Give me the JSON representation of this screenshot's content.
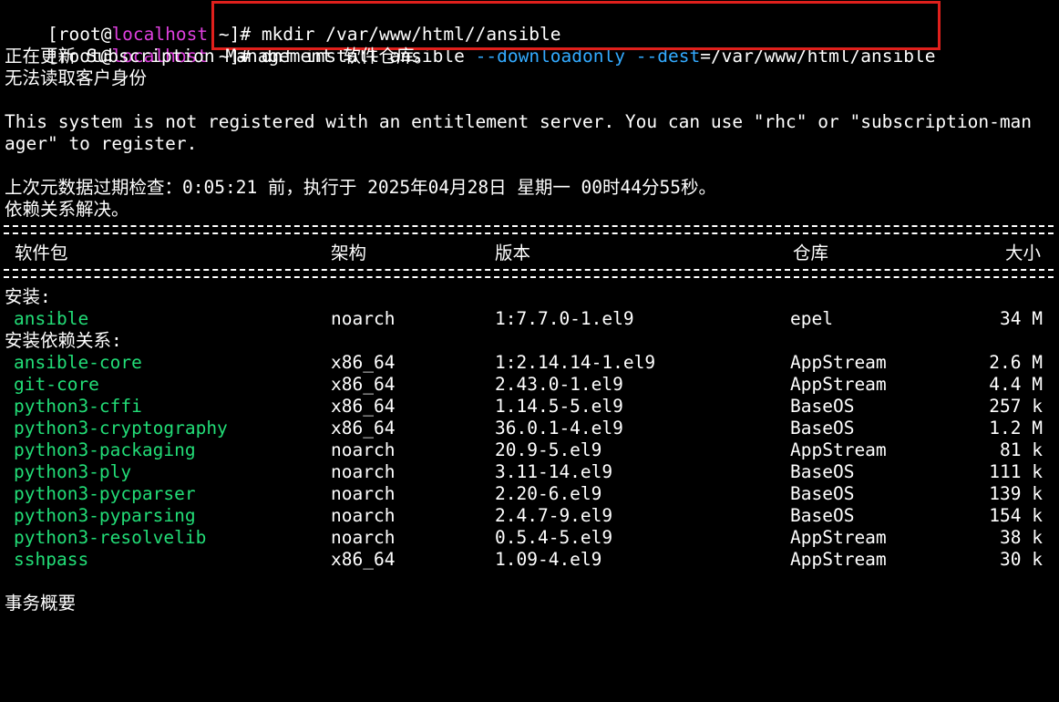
{
  "prompt": {
    "bracket_open": "[",
    "user": "root",
    "at": "@",
    "host": "localhost",
    "dir_and_sign": " ~]# "
  },
  "commands": [
    {
      "text": "mkdir /var/www/html//ansible"
    },
    {
      "pre": "dnf install ansible ",
      "opt1": "--downloadonly",
      "mid": " ",
      "opt2": "--dest",
      "post": "=/var/www/html/ansible"
    }
  ],
  "output": {
    "line1": "正在更新 Subscription Management 软件仓库。",
    "line2": "无法读取客户身份",
    "line3": "This system is not registered with an entitlement server. You can use \"rhc\" or \"subscription-man",
    "line4": "ager\" to register.",
    "line5": "上次元数据过期检查：0:05:21 前，执行于 2025年04月28日 星期一 00时44分55秒。",
    "line6": "依赖关系解决。"
  },
  "table": {
    "headers": {
      "name": "软件包",
      "arch": "架构",
      "version": "版本",
      "repo": "仓库",
      "size": "大小"
    },
    "install_label": "安装:",
    "install": [
      {
        "name": "ansible",
        "arch": "noarch",
        "version": "1:7.7.0-1.el9",
        "repo": "epel",
        "size": "34 M"
      }
    ],
    "deps_label": "安装依赖关系:",
    "deps": [
      {
        "name": "ansible-core",
        "arch": "x86_64",
        "version": "1:2.14.14-1.el9",
        "repo": "AppStream",
        "size": "2.6 M"
      },
      {
        "name": "git-core",
        "arch": "x86_64",
        "version": "2.43.0-1.el9",
        "repo": "AppStream",
        "size": "4.4 M"
      },
      {
        "name": "python3-cffi",
        "arch": "x86_64",
        "version": "1.14.5-5.el9",
        "repo": "BaseOS",
        "size": "257 k"
      },
      {
        "name": "python3-cryptography",
        "arch": "x86_64",
        "version": "36.0.1-4.el9",
        "repo": "BaseOS",
        "size": "1.2 M"
      },
      {
        "name": "python3-packaging",
        "arch": "noarch",
        "version": "20.9-5.el9",
        "repo": "AppStream",
        "size": "81 k"
      },
      {
        "name": "python3-ply",
        "arch": "noarch",
        "version": "3.11-14.el9",
        "repo": "BaseOS",
        "size": "111 k"
      },
      {
        "name": "python3-pycparser",
        "arch": "noarch",
        "version": "2.20-6.el9",
        "repo": "BaseOS",
        "size": "139 k"
      },
      {
        "name": "python3-pyparsing",
        "arch": "noarch",
        "version": "2.4.7-9.el9",
        "repo": "BaseOS",
        "size": "154 k"
      },
      {
        "name": "python3-resolvelib",
        "arch": "noarch",
        "version": "0.5.4-5.el9",
        "repo": "AppStream",
        "size": "38 k"
      },
      {
        "name": "sshpass",
        "arch": "x86_64",
        "version": "1.09-4.el9",
        "repo": "AppStream",
        "size": "30 k"
      }
    ]
  },
  "summary_label": "事务概要",
  "colors": {
    "background": "#000000",
    "text": "#ffffff",
    "host": "#e040e0",
    "option": "#33aaff",
    "package": "#22dd77",
    "highlight_box": "#e0201c"
  }
}
